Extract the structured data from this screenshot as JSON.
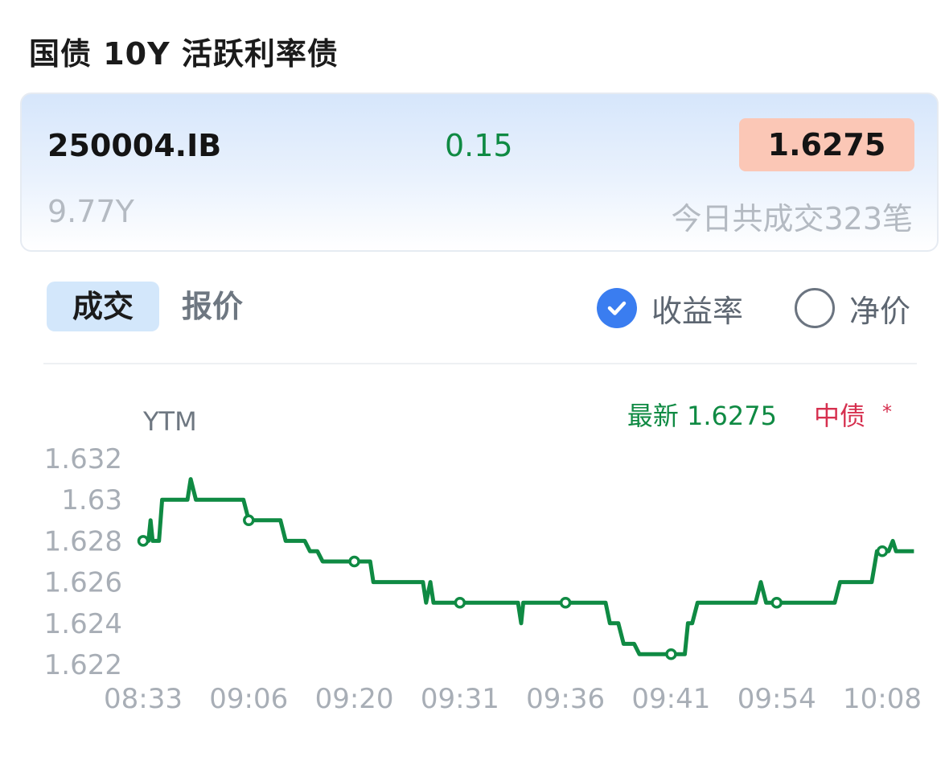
{
  "page": {
    "title": "国债 10Y 活跃利率债"
  },
  "bond": {
    "code": "250004.IB",
    "change": "0.15",
    "price": "1.6275",
    "term": "9.77Y",
    "trades_text": "今日共成交323笔"
  },
  "tabs": [
    {
      "label": "成交",
      "active": true
    },
    {
      "label": "报价",
      "active": false
    }
  ],
  "options": [
    {
      "label": "收益率",
      "checked": true
    },
    {
      "label": "净价",
      "checked": false
    }
  ],
  "colors": {
    "up_green": "#0f8a43",
    "price_bg": "#fbc7b6",
    "accent_blue": "#3a7df0",
    "tab_bg": "#d3e7fb",
    "cdb_red": "#d6304f"
  },
  "chart_data": {
    "type": "line",
    "ylabel": "YTM",
    "latest_label": "最新 1.6275",
    "source_label": "中债",
    "source_mark": "*",
    "ylim": [
      1.6215,
      1.633
    ],
    "yticks": [
      "1.632",
      "1.63",
      "1.628",
      "1.626",
      "1.624",
      "1.622"
    ],
    "xticks": [
      "08:33",
      "09:06",
      "09:20",
      "09:31",
      "09:36",
      "09:41",
      "09:54",
      "10:08"
    ],
    "series": [
      {
        "points": [
          [
            0,
            1.628
          ],
          [
            0.05,
            1.628
          ],
          [
            0.07,
            1.629
          ],
          [
            0.09,
            1.628
          ],
          [
            0.15,
            1.628
          ],
          [
            0.18,
            1.63
          ],
          [
            0.42,
            1.63
          ],
          [
            0.45,
            1.631
          ],
          [
            0.5,
            1.63
          ],
          [
            0.95,
            1.63
          ],
          [
            1,
            1.629
          ],
          [
            1.3,
            1.629
          ],
          [
            1.35,
            1.628
          ],
          [
            1.53,
            1.628
          ],
          [
            1.58,
            1.6275
          ],
          [
            1.65,
            1.6275
          ],
          [
            1.7,
            1.627
          ],
          [
            2,
            1.627
          ],
          [
            2.15,
            1.627
          ],
          [
            2.18,
            1.626
          ],
          [
            2.65,
            1.626
          ],
          [
            2.68,
            1.625
          ],
          [
            2.72,
            1.626
          ],
          [
            2.75,
            1.625
          ],
          [
            3,
            1.625
          ],
          [
            3.55,
            1.625
          ],
          [
            3.58,
            1.624
          ],
          [
            3.6,
            1.625
          ],
          [
            4,
            1.625
          ],
          [
            4.38,
            1.625
          ],
          [
            4.42,
            1.624
          ],
          [
            4.5,
            1.624
          ],
          [
            4.55,
            1.623
          ],
          [
            4.65,
            1.623
          ],
          [
            4.7,
            1.6225
          ],
          [
            5,
            1.6225
          ],
          [
            5.13,
            1.6225
          ],
          [
            5.16,
            1.624
          ],
          [
            5.2,
            1.624
          ],
          [
            5.25,
            1.625
          ],
          [
            5.8,
            1.625
          ],
          [
            5.85,
            1.626
          ],
          [
            5.9,
            1.625
          ],
          [
            6,
            1.625
          ],
          [
            6.55,
            1.625
          ],
          [
            6.6,
            1.626
          ],
          [
            6.9,
            1.626
          ],
          [
            6.95,
            1.6275
          ],
          [
            7,
            1.6275
          ],
          [
            7.06,
            1.6275
          ],
          [
            7.1,
            1.628
          ],
          [
            7.13,
            1.6275
          ],
          [
            7.3,
            1.6275
          ]
        ],
        "markers": [
          [
            0,
            1.628
          ],
          [
            1,
            1.629
          ],
          [
            2,
            1.627
          ],
          [
            3,
            1.625
          ],
          [
            4,
            1.625
          ],
          [
            5,
            1.6225
          ],
          [
            6,
            1.625
          ],
          [
            7,
            1.6275
          ]
        ]
      }
    ]
  }
}
